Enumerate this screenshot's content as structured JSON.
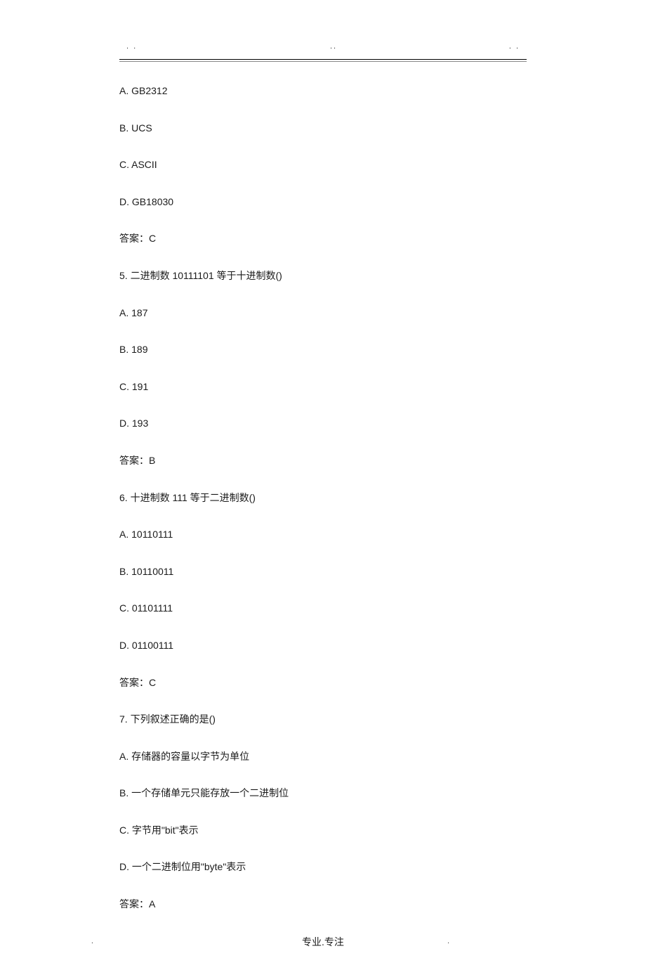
{
  "top_marks": {
    "left": ". .",
    "center": "..",
    "right": ". ."
  },
  "q4": {
    "optA": "A. GB2312",
    "optB": "B. UCS",
    "optC": "C. ASCII",
    "optD": "D. GB18030",
    "answer": "答案：C"
  },
  "q5": {
    "stem": "5. 二进制数 10111101 等于十进制数()",
    "optA": "A. 187",
    "optB": "B. 189",
    "optC": "C. 191",
    "optD": "D. 193",
    "answer": "答案：B"
  },
  "q6": {
    "stem": "6. 十进制数 111 等于二进制数()",
    "optA": "A. 10110111",
    "optB": "B. 10110011",
    "optC": "C. 01101111",
    "optD": "D. 01100111",
    "answer": "答案：C"
  },
  "q7": {
    "stem": "7. 下列叙述正确的是()",
    "optA": "A. 存储器的容量以字节为单位",
    "optB": "B. 一个存储单元只能存放一个二进制位",
    "optC": "C. 字节用\"bit\"表示",
    "optD": "D. 一个二进制位用\"byte\"表示",
    "answer": "答案：A"
  },
  "footer": {
    "text": "专业.专注",
    "dot": "."
  }
}
